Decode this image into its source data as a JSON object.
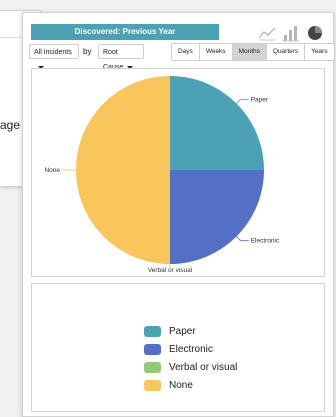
{
  "background": {
    "cut_text": "age"
  },
  "banner": {
    "title": "Discovered: Previous Year"
  },
  "chart_type_icons": [
    "line-chart-icon",
    "bar-chart-icon",
    "pie-chart-icon"
  ],
  "filters": {
    "incidents_dropdown": "All Incidents",
    "by_label": "by",
    "group_dropdown": "Root Cause"
  },
  "period_buttons": [
    {
      "label": "Days",
      "active": false
    },
    {
      "label": "Weeks",
      "active": false
    },
    {
      "label": "Months",
      "active": true
    },
    {
      "label": "Quarters",
      "active": false
    },
    {
      "label": "Years",
      "active": false
    }
  ],
  "chart_data": {
    "type": "pie",
    "slices": [
      {
        "label": "Paper",
        "value": 25,
        "color": "#4aa2b4"
      },
      {
        "label": "Electronic",
        "value": 25,
        "color": "#5470c6"
      },
      {
        "label": "Verbal or visual",
        "value": 0,
        "color": "#91cc75"
      },
      {
        "label": "None",
        "value": 50,
        "color": "#f9c65c"
      }
    ],
    "legend_placement": "bottom"
  }
}
